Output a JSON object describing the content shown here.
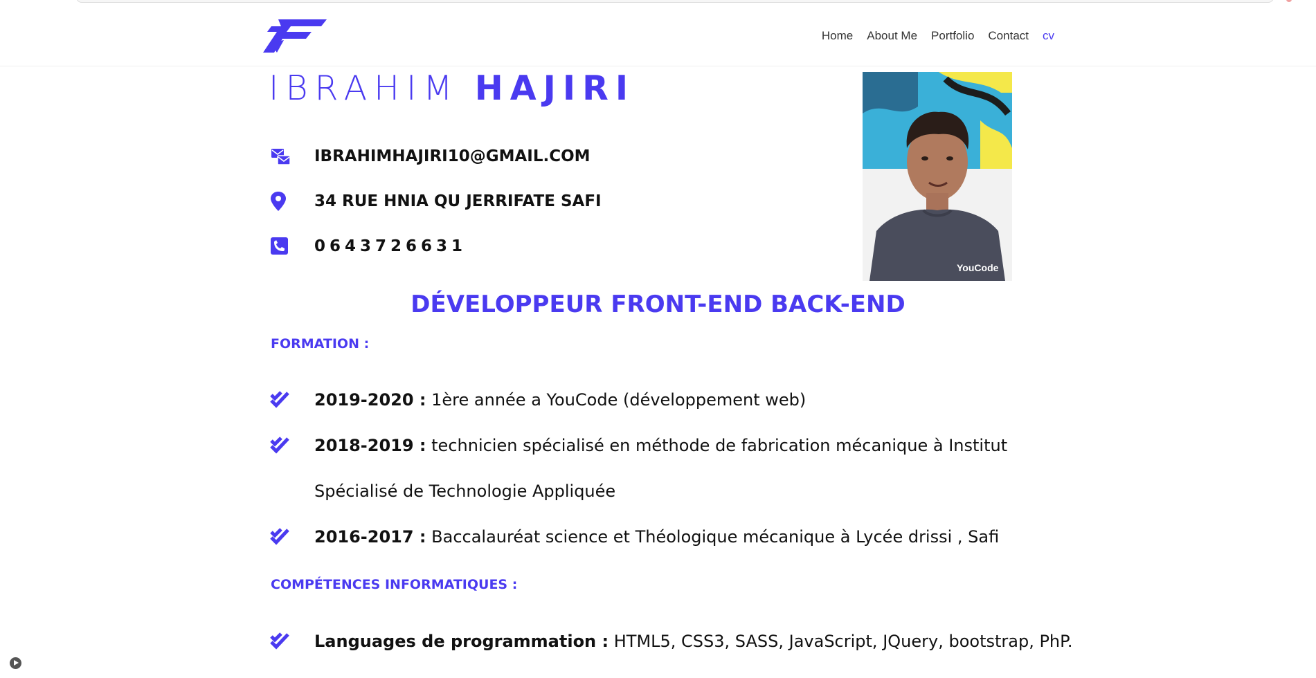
{
  "nav": {
    "items": [
      {
        "label": "Home"
      },
      {
        "label": "About Me"
      },
      {
        "label": "Portfolio"
      },
      {
        "label": "Contact"
      },
      {
        "label": "cv"
      }
    ],
    "active_index": 4
  },
  "profile": {
    "first_name": "IBRAHIM",
    "last_name": "HAJIRI",
    "email": "IBRAHIMHAJIRI10@GMAIL.COM",
    "address": "34 RUE HNIA QU JERRIFATE SAFI",
    "phone": "0643726631",
    "role": "DÉVELOPPEUR FRONT-END BACK-END"
  },
  "formation": {
    "title": "FORMATION :",
    "items": [
      {
        "label": "2019-2020 :",
        "desc": " 1ère année a YouCode (développement web)"
      },
      {
        "label": "2018-2019 :",
        "desc": " technicien spécialisé en méthode de fabrication mécanique à Institut Spécialisé de Technologie Appliquée"
      },
      {
        "label": "2016-2017 :",
        "desc": " Baccalauréat science et Théologique mécanique à Lycée drissi , Safi"
      }
    ]
  },
  "competences": {
    "title": "COMPÉTENCES INFORMATIQUES :",
    "items": [
      {
        "label": "Languages de programmation :",
        "desc": " HTML5, CSS3, SASS, JavaScript, JQuery, bootstrap, PhP."
      }
    ]
  },
  "photo_badge_text": "YouCode",
  "colors": {
    "accent": "#4a3af0",
    "text": "#111111",
    "nav_text": "#333333"
  },
  "icons": {
    "logo": "f-logo-icon",
    "email": "mail-icon",
    "address": "map-marker-icon",
    "phone": "phone-icon",
    "check": "double-check-icon",
    "play": "play-icon"
  }
}
